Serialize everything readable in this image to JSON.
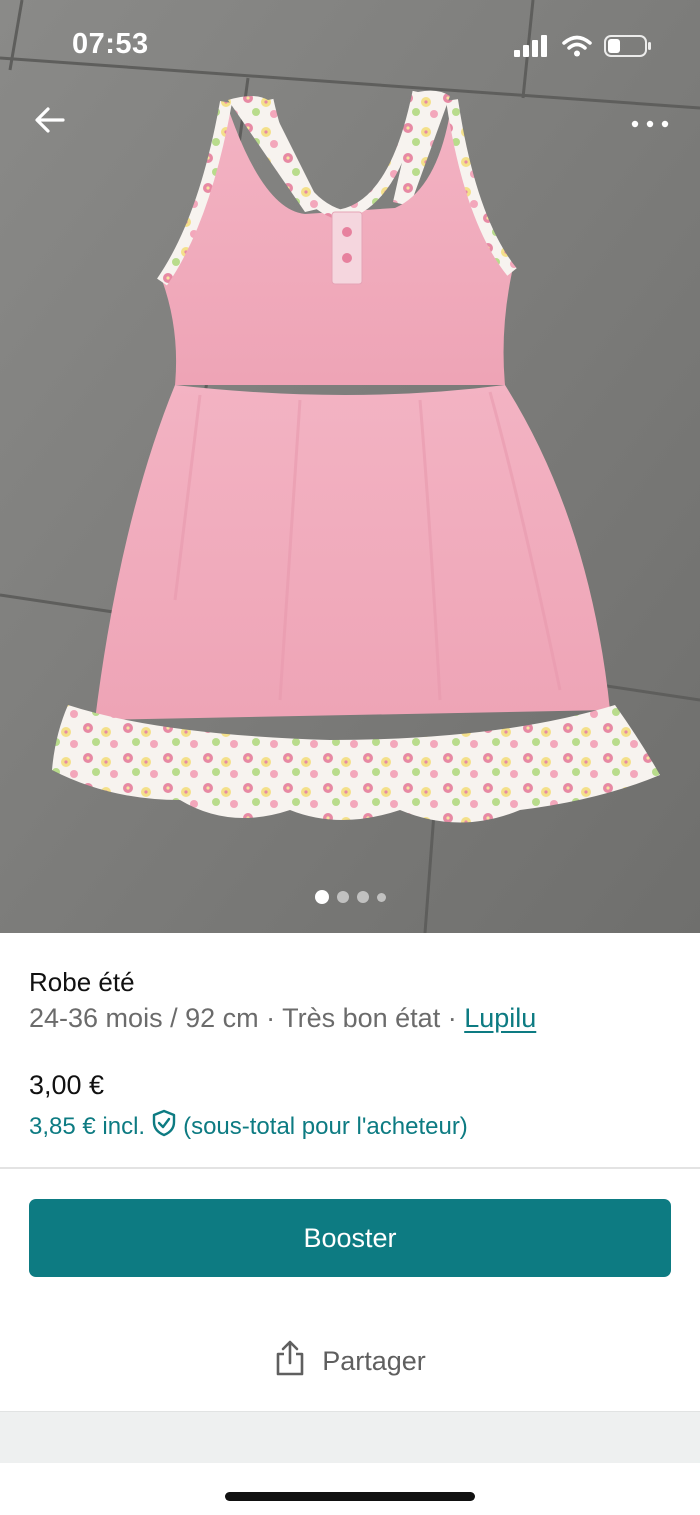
{
  "status_bar": {
    "time": "07:53"
  },
  "gallery": {
    "image_count": 4,
    "active_index": 0
  },
  "listing": {
    "title": "Robe été",
    "size": "24-36 mois / 92 cm",
    "separator": " · ",
    "condition": "Très bon état",
    "brand": "Lupilu",
    "price": "3,00 €",
    "price_incl": "3,85 € incl.",
    "buyer_note": "(sous-total pour l'acheteur)"
  },
  "actions": {
    "booster_label": "Booster",
    "share_label": "Partager"
  },
  "colors": {
    "accent": "#0d7b82",
    "dress_pink": "#f2a9bb",
    "floor_gray": "#7f7f7d"
  },
  "icons": [
    "back-arrow-icon",
    "more-dots-icon",
    "signal-icon",
    "wifi-icon",
    "battery-icon",
    "shield-check-icon",
    "share-icon"
  ]
}
